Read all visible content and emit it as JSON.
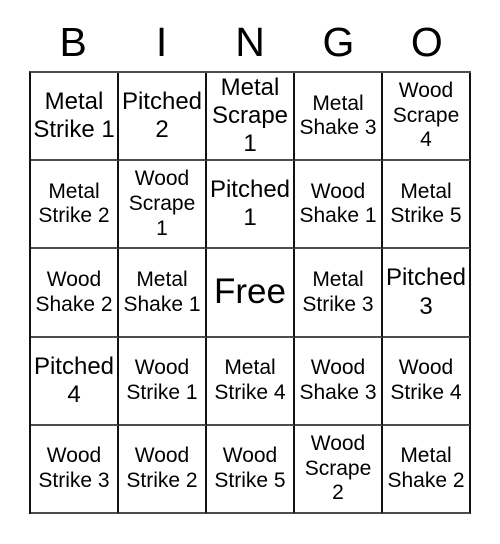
{
  "card": {
    "title": "BINGO",
    "headers": [
      "B",
      "I",
      "N",
      "G",
      "O"
    ],
    "free_label": "Free",
    "colors": {
      "background": "#ffffff",
      "text": "#000000",
      "grid_line": "#111111",
      "grid_line_soft": "#4d4d4d"
    },
    "rows": [
      [
        {
          "text": "Metal Strike 1",
          "lines": 2
        },
        {
          "text": "Pitched 2",
          "lines": 2
        },
        {
          "text": "Metal Scrape 1",
          "lines": 2
        },
        {
          "text": "Metal Shake 3",
          "lines": 3
        },
        {
          "text": "Wood Scrape 4",
          "lines": 3
        }
      ],
      [
        {
          "text": "Metal Strike 2",
          "lines": 3
        },
        {
          "text": "Wood Scrape 1",
          "lines": 3
        },
        {
          "text": "Pitched 1",
          "lines": 2
        },
        {
          "text": "Wood Shake 1",
          "lines": 3
        },
        {
          "text": "Metal Strike 5",
          "lines": 3
        }
      ],
      [
        {
          "text": "Wood Shake 2",
          "lines": 3
        },
        {
          "text": "Metal Shake 1",
          "lines": 3
        },
        {
          "text": "Free",
          "lines": 1,
          "free": true
        },
        {
          "text": "Metal Strike 3",
          "lines": 3
        },
        {
          "text": "Pitched 3",
          "lines": 2
        }
      ],
      [
        {
          "text": "Pitched 4",
          "lines": 2
        },
        {
          "text": "Wood Strike 1",
          "lines": 3
        },
        {
          "text": "Metal Strike 4",
          "lines": 3
        },
        {
          "text": "Wood Shake 3",
          "lines": 3
        },
        {
          "text": "Wood Strike 4",
          "lines": 3
        }
      ],
      [
        {
          "text": "Wood Strike 3",
          "lines": 3
        },
        {
          "text": "Wood Strike 2",
          "lines": 3
        },
        {
          "text": "Wood Strike 5",
          "lines": 3
        },
        {
          "text": "Wood Scrape 2",
          "lines": 3
        },
        {
          "text": "Metal Shake 2",
          "lines": 3
        }
      ]
    ]
  }
}
